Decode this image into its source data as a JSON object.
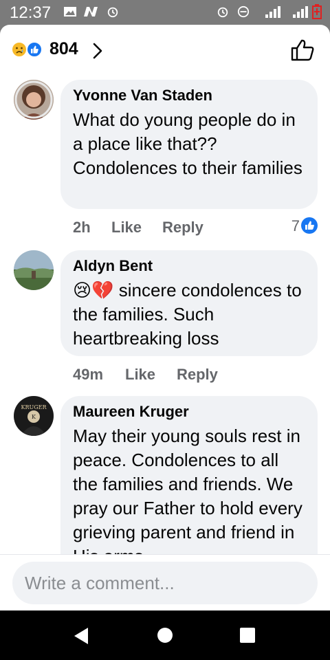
{
  "status_bar": {
    "time": "12:37"
  },
  "header": {
    "reaction_count": "804"
  },
  "comments": [
    {
      "author": "Yvonne Van Staden",
      "text": "What do young people do in a place like that?? Condolences to their families",
      "time": "2h",
      "like_label": "Like",
      "reply_label": "Reply",
      "likes": "7"
    },
    {
      "author": "Aldyn Bent",
      "emoji": "😢💔",
      "text": "sincere condolences to the families. Such heartbreaking loss",
      "time": "49m",
      "like_label": "Like",
      "reply_label": "Reply"
    },
    {
      "author": "Maureen Kruger",
      "text": "May their young souls rest in peace. Condolences to all the families and friends. We pray our Father to hold every grieving parent and friend in His arms",
      "avatar_text": "KRUGER"
    }
  ],
  "composer": {
    "placeholder": "Write a comment..."
  },
  "icons": [
    "alarm-icon",
    "minus-circle-icon",
    "signal-icon",
    "battery-icon",
    "sad-reaction-icon",
    "like-reaction-icon",
    "chevron-right-icon",
    "thumbs-up-icon",
    "back-icon",
    "home-icon",
    "recents-icon"
  ],
  "colors": {
    "accent": "#1877f2",
    "bubble": "#f0f2f5",
    "secondary_text": "#65676b",
    "sad": "#f7b928",
    "battery": "#e02020"
  }
}
